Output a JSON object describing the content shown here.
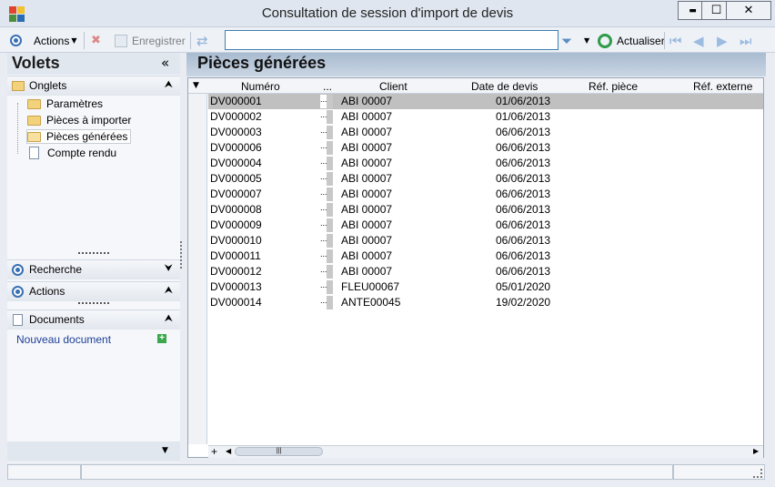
{
  "window": {
    "title": "Consultation de session d'import de devis",
    "minimize": "▬",
    "maximize": "☐",
    "close": "✕"
  },
  "toolbar": {
    "actions_label": "Actions",
    "save_label": "Enregistrer",
    "search_value": "",
    "refresh_label": "Actualiser"
  },
  "leftpane": {
    "title": "Volets",
    "collapse_glyph": "«",
    "onglets_label": "Onglets",
    "tree": [
      {
        "label": "Paramètres",
        "icon": "folder-icon"
      },
      {
        "label": "Pièces à importer",
        "icon": "folder-icon"
      },
      {
        "label": "Pièces générées",
        "icon": "folder-open-icon"
      },
      {
        "label": "Compte rendu",
        "icon": "document-icon"
      }
    ],
    "recherche_label": "Recherche",
    "actions_label": "Actions",
    "documents_label": "Documents",
    "new_document_label": "Nouveau document"
  },
  "main": {
    "title": "Pièces générées",
    "columns": {
      "numero": "Numéro",
      "dots": "...",
      "client": "Client",
      "date": "Date de devis",
      "ref_piece": "Réf. pièce",
      "ref_externe": "Réf. externe"
    },
    "rows": [
      {
        "numero": "DV000001",
        "client": "ABI 00007",
        "date": "01/06/2013"
      },
      {
        "numero": "DV000002",
        "client": "ABI 00007",
        "date": "01/06/2013"
      },
      {
        "numero": "DV000003",
        "client": "ABI 00007",
        "date": "06/06/2013"
      },
      {
        "numero": "DV000006",
        "client": "ABI 00007",
        "date": "06/06/2013"
      },
      {
        "numero": "DV000004",
        "client": "ABI 00007",
        "date": "06/06/2013"
      },
      {
        "numero": "DV000005",
        "client": "ABI 00007",
        "date": "06/06/2013"
      },
      {
        "numero": "DV000007",
        "client": "ABI 00007",
        "date": "06/06/2013"
      },
      {
        "numero": "DV000008",
        "client": "ABI 00007",
        "date": "06/06/2013"
      },
      {
        "numero": "DV000009",
        "client": "ABI 00007",
        "date": "06/06/2013"
      },
      {
        "numero": "DV000010",
        "client": "ABI 00007",
        "date": "06/06/2013"
      },
      {
        "numero": "DV000011",
        "client": "ABI 00007",
        "date": "06/06/2013"
      },
      {
        "numero": "DV000012",
        "client": "ABI 00007",
        "date": "06/06/2013"
      },
      {
        "numero": "DV000013",
        "client": "FLEU00067",
        "date": "05/01/2020"
      },
      {
        "numero": "DV000014",
        "client": "ANTE00045",
        "date": "19/02/2020"
      }
    ],
    "dots_cell": "..."
  },
  "colors": {
    "accent": "#3a6fb5",
    "selected_row": "#c0c0c0",
    "link": "#1f3f99"
  }
}
